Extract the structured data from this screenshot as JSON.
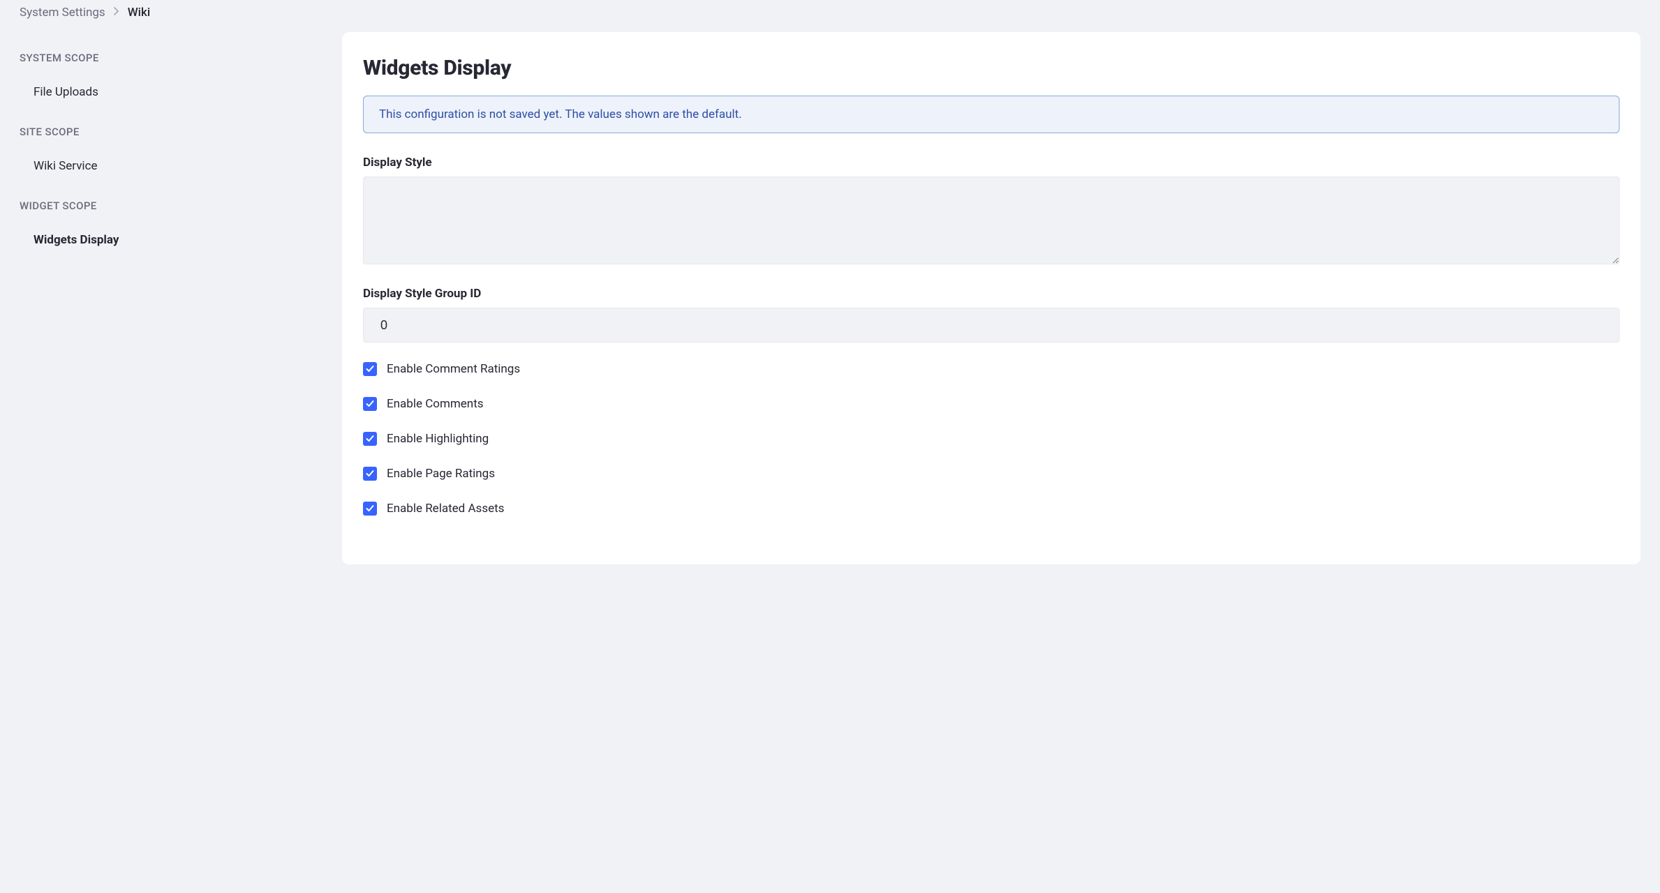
{
  "breadcrumb": {
    "parent": "System Settings",
    "current": "Wiki"
  },
  "sidebar": {
    "groups": [
      {
        "label": "SYSTEM SCOPE",
        "items": [
          {
            "label": "File Uploads",
            "active": false
          }
        ]
      },
      {
        "label": "SITE SCOPE",
        "items": [
          {
            "label": "Wiki Service",
            "active": false
          }
        ]
      },
      {
        "label": "WIDGET SCOPE",
        "items": [
          {
            "label": "Widgets Display",
            "active": true
          }
        ]
      }
    ]
  },
  "main": {
    "title": "Widgets Display",
    "alert": "This configuration is not saved yet. The values shown are the default.",
    "fields": {
      "displayStyle": {
        "label": "Display Style",
        "value": ""
      },
      "displayStyleGroupId": {
        "label": "Display Style Group ID",
        "value": "0"
      }
    },
    "checkboxes": [
      {
        "label": "Enable Comment Ratings",
        "checked": true
      },
      {
        "label": "Enable Comments",
        "checked": true
      },
      {
        "label": "Enable Highlighting",
        "checked": true
      },
      {
        "label": "Enable Page Ratings",
        "checked": true
      },
      {
        "label": "Enable Related Assets",
        "checked": true
      }
    ]
  }
}
